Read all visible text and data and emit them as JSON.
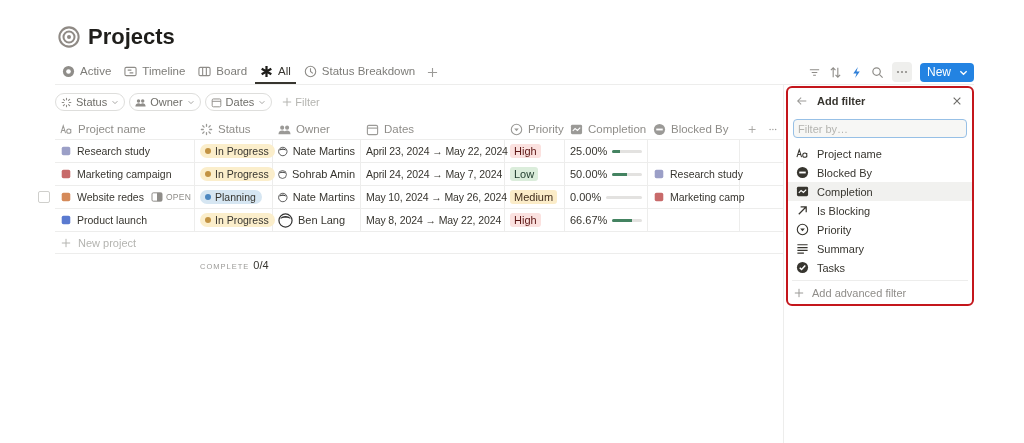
{
  "title": "Projects",
  "views": [
    {
      "label": "Active",
      "kind": "active",
      "selected": false
    },
    {
      "label": "Timeline",
      "kind": "timeline",
      "selected": false
    },
    {
      "label": "Board",
      "kind": "board",
      "selected": false
    },
    {
      "label": "All",
      "kind": "all",
      "selected": true
    },
    {
      "label": "Status Breakdown",
      "kind": "chart",
      "selected": false
    }
  ],
  "new_button": "New",
  "filter_chips": [
    {
      "label": "Status",
      "kind": "status"
    },
    {
      "label": "Owner",
      "kind": "person"
    },
    {
      "label": "Dates",
      "kind": "date"
    }
  ],
  "add_filter": "Filter",
  "columns": [
    {
      "label": "Project name",
      "kind": "title"
    },
    {
      "label": "Status",
      "kind": "status"
    },
    {
      "label": "Owner",
      "kind": "person"
    },
    {
      "label": "Dates",
      "kind": "date"
    },
    {
      "label": "Priority",
      "kind": "select"
    },
    {
      "label": "Completion",
      "kind": "rollup"
    },
    {
      "label": "Blocked By",
      "kind": "relation"
    }
  ],
  "rows": [
    {
      "name": "Research study",
      "checked": false,
      "status": {
        "label": "In Progress",
        "kind": "progress"
      },
      "owner": "Nate Martins",
      "dates": "April 23, 2024 → May 22, 2024",
      "priority": {
        "label": "High",
        "kind": "high"
      },
      "completion": "25.00%",
      "level": 0.25
    },
    {
      "name": "Marketing campaign",
      "checked": false,
      "status": {
        "label": "In Progress",
        "kind": "progress"
      },
      "owner": "Sohrab Amin",
      "dates": "April 24, 2024 → May 7, 2024",
      "priority": {
        "label": "Low",
        "kind": "low"
      },
      "completion": "50.00%",
      "level": 0.5,
      "blocked_by": "Research study"
    },
    {
      "name": "Website redes",
      "checked": false,
      "open_label": "OPEN",
      "status": {
        "label": "Planning",
        "kind": "planning"
      },
      "owner": "Nate Martins",
      "dates": "May 10, 2024 → May 26, 2024",
      "priority": {
        "label": "Medium",
        "kind": "medium"
      },
      "completion": "0.00%",
      "level": 0,
      "blocked_by": "Marketing camp"
    },
    {
      "name": "Product launch",
      "checked": false,
      "status": {
        "label": "In Progress",
        "kind": "progress"
      },
      "owner": "Ben Lang",
      "dates": "May 8, 2024 → May 22, 2024",
      "priority": {
        "label": "High",
        "kind": "high"
      },
      "completion": "66.67%",
      "level": 0.6667
    }
  ],
  "new_row": "New project",
  "footer": {
    "label": "COMPLETE",
    "value": "0/4"
  },
  "filter_panel": {
    "title": "Add filter",
    "placeholder": "Filter by…",
    "options": [
      {
        "label": "Project name",
        "kind": "title",
        "selected": false
      },
      {
        "label": "Blocked By",
        "kind": "relation",
        "selected": false
      },
      {
        "label": "Completion",
        "kind": "rollup",
        "selected": true
      },
      {
        "label": "Is Blocking",
        "kind": "arrow",
        "selected": false
      },
      {
        "label": "Priority",
        "kind": "select",
        "selected": false
      },
      {
        "label": "Summary",
        "kind": "text",
        "selected": false
      },
      {
        "label": "Tasks",
        "kind": "check",
        "selected": false
      }
    ],
    "advanced": "Add advanced filter"
  }
}
